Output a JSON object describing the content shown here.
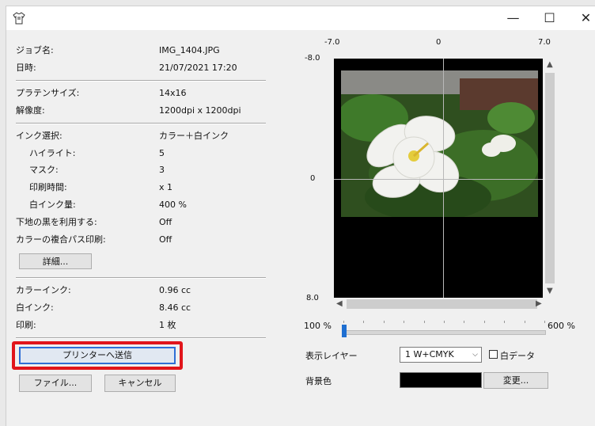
{
  "window": {
    "minimize_glyph": "—",
    "maximize_glyph": "☐",
    "close_glyph": "✕"
  },
  "info": {
    "job_name": {
      "label": "ジョブ名:",
      "value": "IMG_1404.JPG"
    },
    "datetime": {
      "label": "日時:",
      "value": "21/07/2021 17:20"
    },
    "platen_size": {
      "label": "プラテンサイズ:",
      "value": "14x16"
    },
    "resolution": {
      "label": "解像度:",
      "value": "1200dpi x 1200dpi"
    },
    "ink_selection": {
      "label": "インク選択:",
      "value": "カラー＋白インク"
    },
    "highlight": {
      "label": "ハイライト:",
      "value": "5"
    },
    "mask": {
      "label": "マスク:",
      "value": "3"
    },
    "print_time": {
      "label": "印刷時間:",
      "value": "x 1"
    },
    "white_ink_amount": {
      "label": "白インク量:",
      "value": "400 %"
    },
    "use_black": {
      "label": "下地の黒を利用する:",
      "value": "Off"
    },
    "multipass": {
      "label": "カラーの複合パス印刷:",
      "value": "Off"
    },
    "color_ink": {
      "label": "カラーインク:",
      "value": "0.96 cc"
    },
    "white_ink": {
      "label": "白インク:",
      "value": "8.46 cc"
    },
    "print": {
      "label": "印刷:",
      "value": "1 枚"
    }
  },
  "buttons": {
    "details": "詳細...",
    "send_to_printer": "プリンターへ送信",
    "file": "ファイル...",
    "cancel": "キャンセル",
    "change": "変更..."
  },
  "preview": {
    "top_ticks": [
      "-7.0",
      "0",
      "7.0"
    ],
    "left_ticks": [
      "-8.0",
      "0",
      "8.0"
    ],
    "image_description_icon": "flower-photo"
  },
  "zoom": {
    "min": "100 %",
    "max": "600 %",
    "value_fraction": 0.0
  },
  "layer": {
    "label": "表示レイヤー",
    "selected": "1  W+CMYK",
    "white_data_label": "白データ",
    "white_data_checked": false
  },
  "background": {
    "label": "背景色",
    "color": "#000000"
  }
}
